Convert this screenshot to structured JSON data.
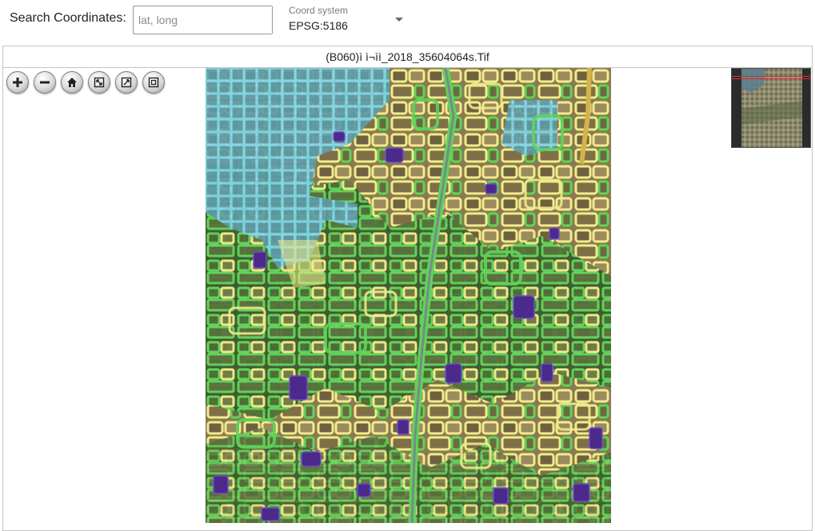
{
  "search": {
    "label": "Search Coordinates:",
    "placeholder": "lat, long",
    "value": ""
  },
  "coord_system": {
    "caption": "Coord system",
    "value": "EPSG:5186"
  },
  "viewer": {
    "title": "(B060)ì ì¬ìì_2018_35604064s.Tif",
    "nav_buttons": [
      {
        "name": "zoom-in-button",
        "icon": "plus-icon"
      },
      {
        "name": "zoom-out-button",
        "icon": "minus-icon"
      },
      {
        "name": "home-button",
        "icon": "home-icon"
      },
      {
        "name": "full-page-button",
        "icon": "full-page-icon"
      },
      {
        "name": "rotate-button",
        "icon": "rotate-icon"
      },
      {
        "name": "fit-button",
        "icon": "fit-icon"
      }
    ]
  },
  "map_colors": {
    "water_overlay": "#7fd6e8",
    "field_overlay": "#f2eb8a",
    "vegetation_overlay": "#5fd35a",
    "building_overlay": "#4b2a8c",
    "road_overlay": "#e8e8e8",
    "overview_box": "#d93030"
  }
}
